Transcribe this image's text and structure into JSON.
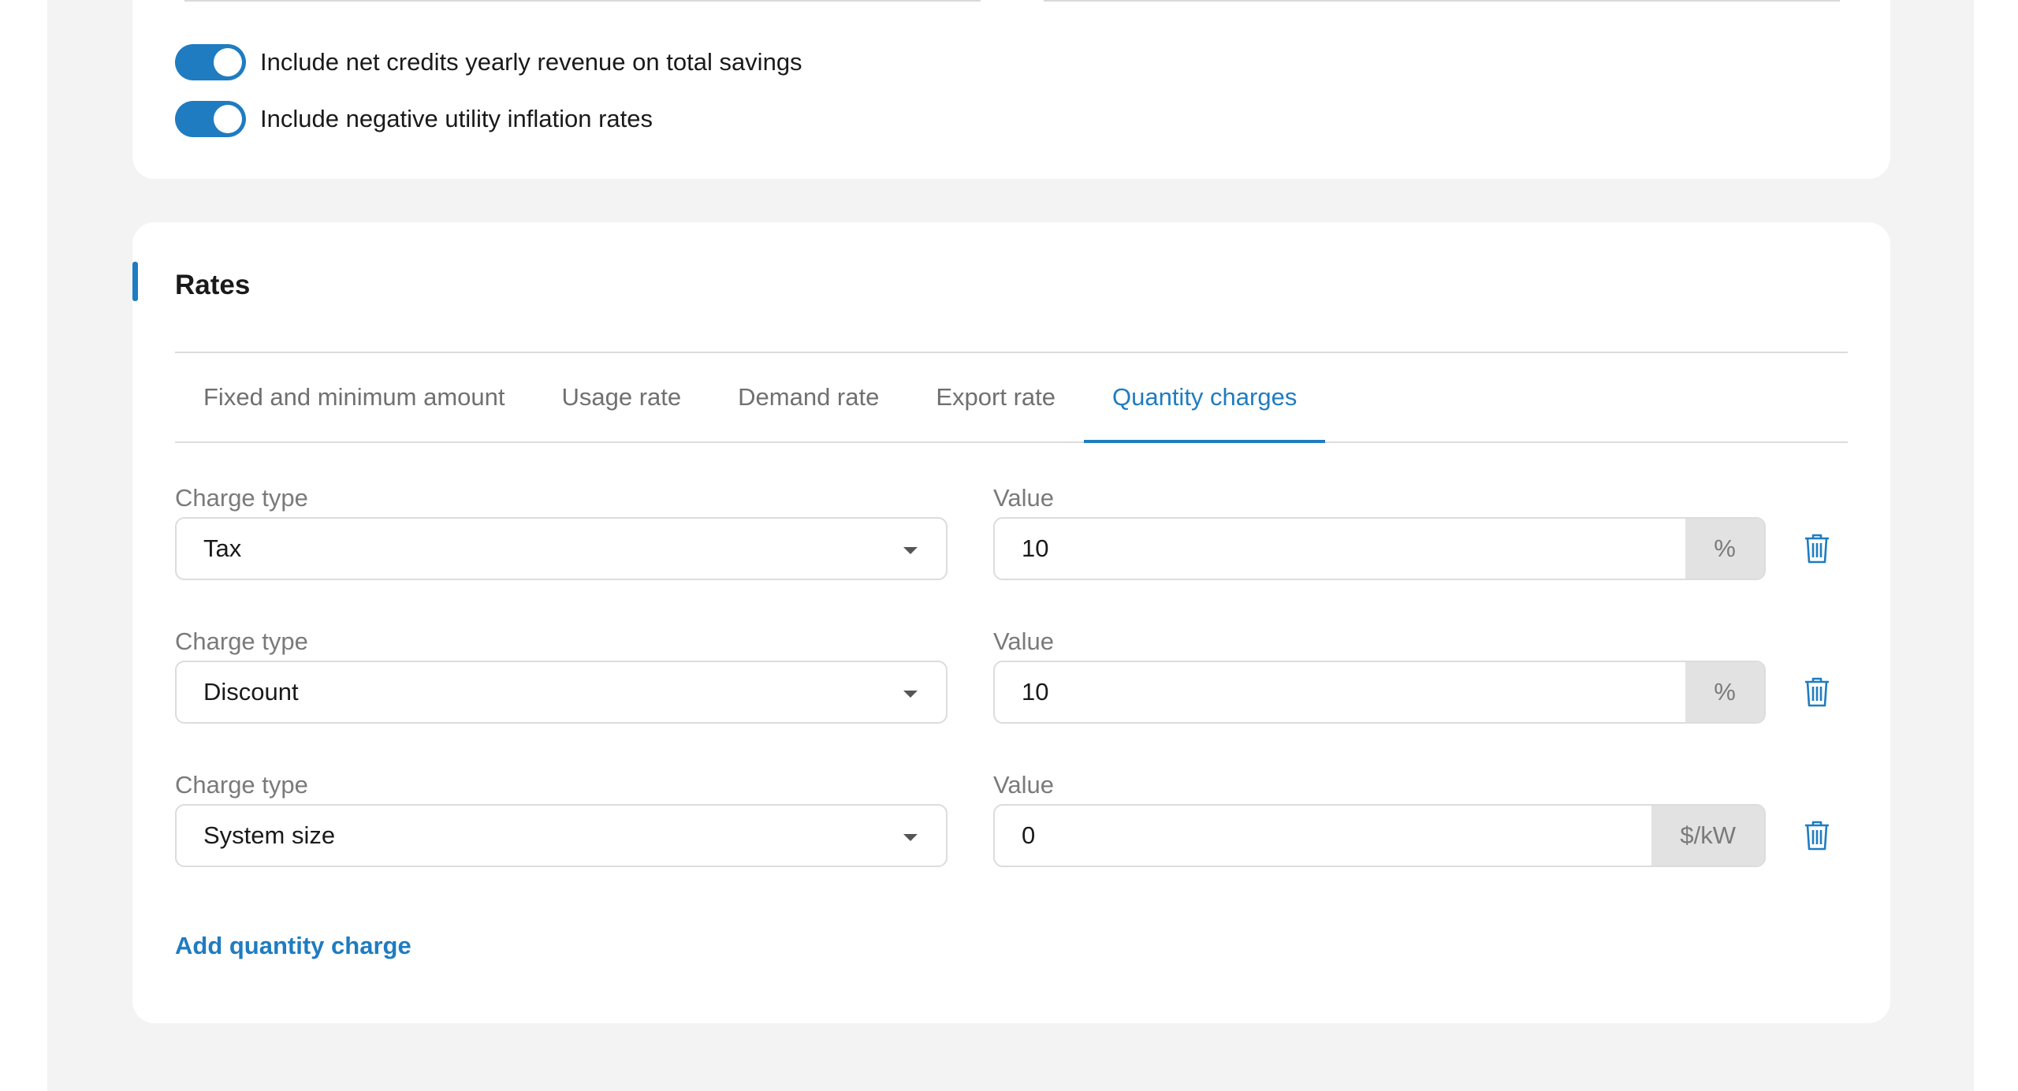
{
  "settings": {
    "toggles": [
      {
        "label": "Include net credits yearly revenue on total savings",
        "on": true
      },
      {
        "label": "Include negative utility inflation rates",
        "on": true
      }
    ]
  },
  "rates": {
    "title": "Rates",
    "tabs": [
      {
        "label": "Fixed and minimum amount",
        "active": false
      },
      {
        "label": "Usage rate",
        "active": false
      },
      {
        "label": "Demand rate",
        "active": false
      },
      {
        "label": "Export rate",
        "active": false
      },
      {
        "label": "Quantity charges",
        "active": true
      }
    ],
    "charges": [
      {
        "type_label": "Charge type",
        "type": "Tax",
        "value_label": "Value",
        "value": "10",
        "unit": "%"
      },
      {
        "type_label": "Charge type",
        "type": "Discount",
        "value_label": "Value",
        "value": "10",
        "unit": "%"
      },
      {
        "type_label": "Charge type",
        "type": "System size",
        "value_label": "Value",
        "value": "0",
        "unit": "$/kW"
      }
    ],
    "add_label": "Add quantity charge"
  },
  "colors": {
    "accent": "#1f7cc0",
    "background": "#f3f3f3"
  }
}
